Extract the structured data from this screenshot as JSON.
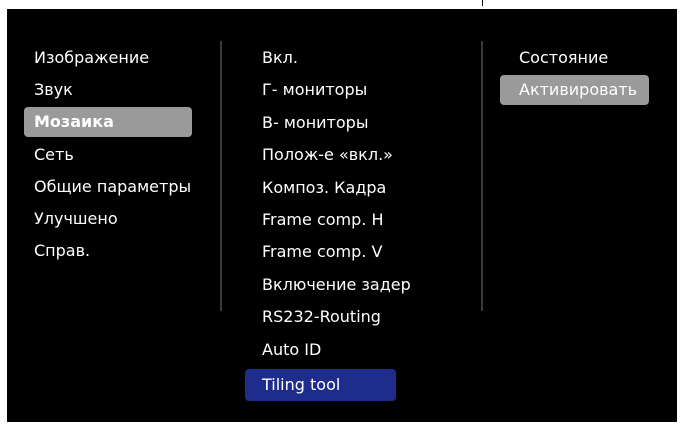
{
  "menu": {
    "main_items": [
      {
        "label": "Изображение"
      },
      {
        "label": "Звук"
      },
      {
        "label": "Мозаика"
      },
      {
        "label": "Сеть"
      },
      {
        "label": "Общие параметры"
      },
      {
        "label": "Улучшено"
      },
      {
        "label": "Справ."
      }
    ],
    "sub_items": [
      {
        "label": "Вкл."
      },
      {
        "label": "Г- мониторы"
      },
      {
        "label": "В- мониторы"
      },
      {
        "label": "Полож-е «вкл.»"
      },
      {
        "label": "Композ. Кадра"
      },
      {
        "label": "Frame comp. H"
      },
      {
        "label": "Frame comp. V"
      },
      {
        "label": "Включение задер"
      },
      {
        "label": "RS232-Routing"
      },
      {
        "label": "Auto ID"
      },
      {
        "label": "Tiling tool"
      }
    ],
    "detail_items": [
      {
        "label": "Состояние"
      },
      {
        "label": "Активировать"
      }
    ]
  },
  "colors": {
    "background": "#000000",
    "text": "#ffffff",
    "selected_main": "#9a9a9a",
    "selected_sub": "#1e2c8c",
    "selected_detail": "#9a9a9a"
  }
}
